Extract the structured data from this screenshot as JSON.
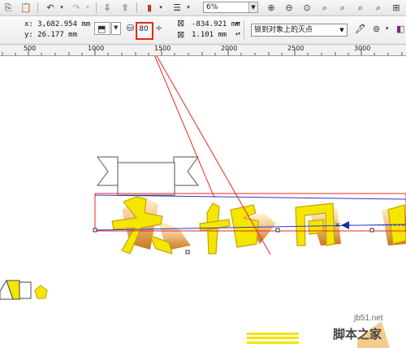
{
  "toolbar": {
    "zoom": {
      "value": "6%"
    }
  },
  "property_bar": {
    "position": {
      "x": "x: 3,682.954 mm",
      "y": "y: 26.177 mm"
    },
    "extrude_depth": "80",
    "vp_position": {
      "x": "-834.921 mm",
      "y": "1.101 mm"
    },
    "vanishing_point_mode": "锁到对象上的灭点"
  },
  "ruler": {
    "labels": [
      "500",
      "1000",
      "1500",
      "2000",
      "2500",
      "3000"
    ]
  },
  "canvas": {
    "artwork_text": "大格国彩"
  },
  "watermark": {
    "site": "jb51.net",
    "name": "脚本之家"
  },
  "colors": {
    "highlight": "#e8281f",
    "selection": "#3333cc",
    "extrude_face": "#f5e600"
  }
}
